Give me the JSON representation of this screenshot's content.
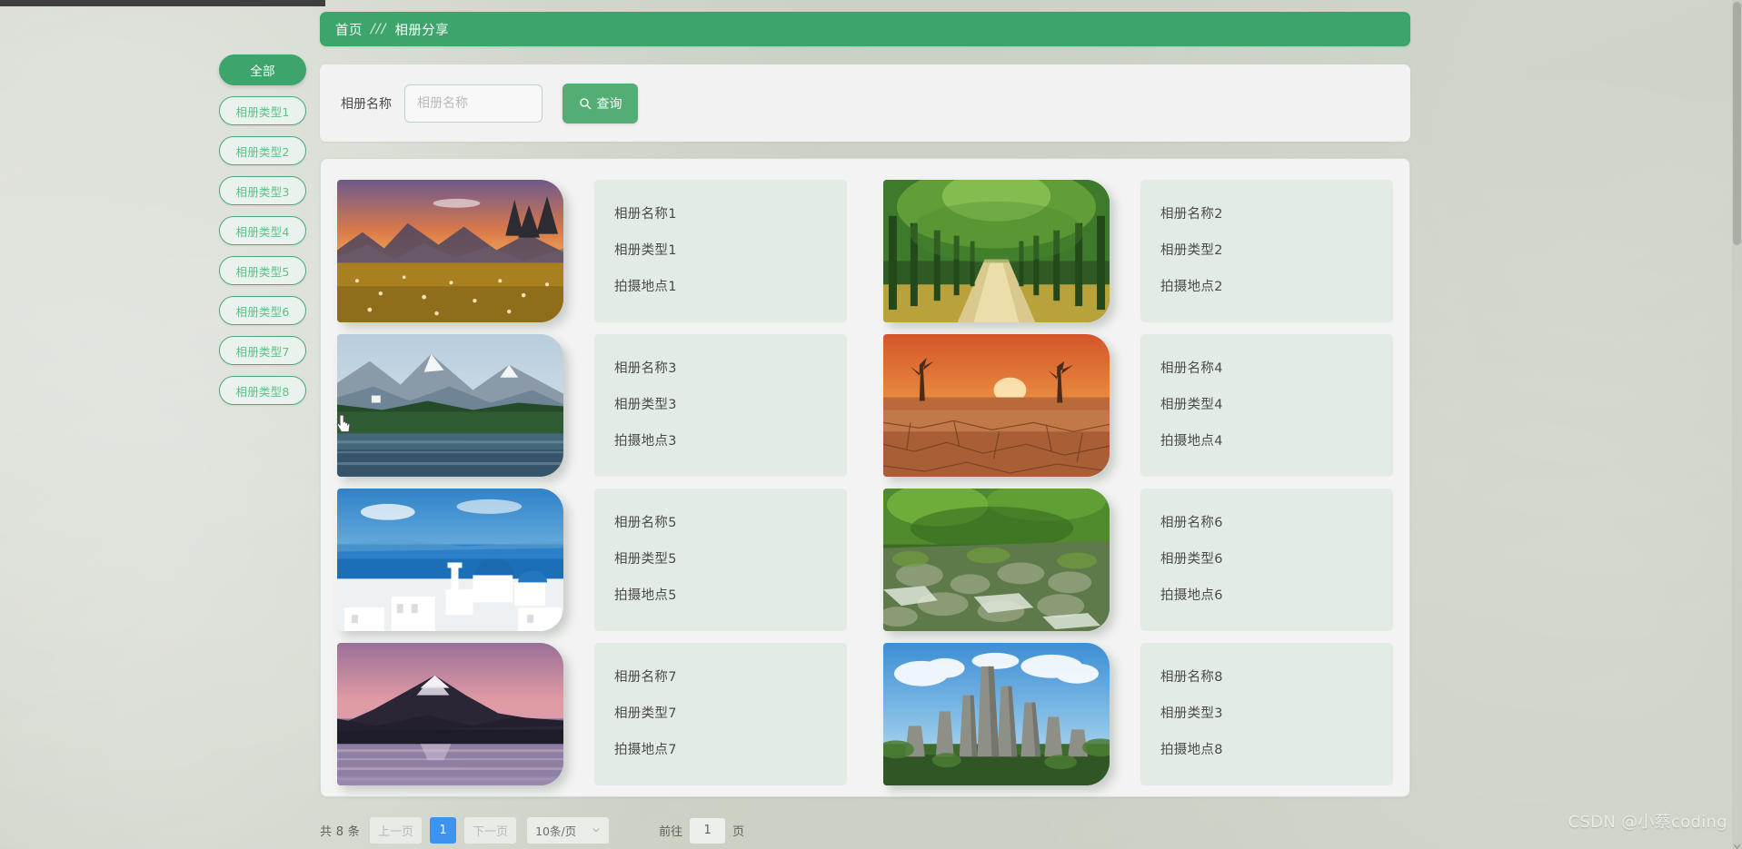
{
  "breadcrumb": {
    "home": "首页",
    "separator": "///",
    "current": "相册分享"
  },
  "sidebar": {
    "items": [
      {
        "label": "全部",
        "active": true
      },
      {
        "label": "相册类型1",
        "active": false
      },
      {
        "label": "相册类型2",
        "active": false
      },
      {
        "label": "相册类型3",
        "active": false
      },
      {
        "label": "相册类型4",
        "active": false
      },
      {
        "label": "相册类型5",
        "active": false
      },
      {
        "label": "相册类型6",
        "active": false
      },
      {
        "label": "相册类型7",
        "active": false
      },
      {
        "label": "相册类型8",
        "active": false
      }
    ]
  },
  "search": {
    "label": "相册名称",
    "placeholder": "相册名称",
    "value": "",
    "button_label": "查询",
    "button_icon": "search-icon"
  },
  "gallery": {
    "cards": [
      {
        "name": "相册名称1",
        "type": "相册类型1",
        "location": "拍摄地点1",
        "image": "sunset-wildflower-meadow"
      },
      {
        "name": "相册名称2",
        "type": "相册类型2",
        "location": "拍摄地点2",
        "image": "tree-lined-road"
      },
      {
        "name": "相册名称3",
        "type": "相册类型3",
        "location": "拍摄地点3",
        "image": "alpine-lake-mountain"
      },
      {
        "name": "相册名称4",
        "type": "相册类型4",
        "location": "拍摄地点4",
        "image": "cracked-desert-sunset"
      },
      {
        "name": "相册名称5",
        "type": "相册类型5",
        "location": "拍摄地点5",
        "image": "santorini-blue-domes"
      },
      {
        "name": "相册名称6",
        "type": "相册类型6",
        "location": "拍摄地点6",
        "image": "mossy-forest-stream"
      },
      {
        "name": "相册名称7",
        "type": "相册类型7",
        "location": "拍摄地点7",
        "image": "pink-sunset-lake"
      },
      {
        "name": "相册名称8",
        "type": "相册类型3",
        "location": "拍摄地点8",
        "image": "stone-forest-pillars"
      }
    ]
  },
  "pagination": {
    "total": "共 8 条",
    "prev": "上一页",
    "current_page": "1",
    "next": "下一页",
    "page_size": "10条/页",
    "jump_prefix": "前往",
    "jump_value": "1",
    "jump_suffix": "页"
  },
  "watermark": "CSDN @小蔡coding",
  "colors": {
    "brand_green": "#3da56c",
    "button_green": "#53ae74",
    "active_page_blue": "#3c93f0",
    "panel_bg": "#f2f3f2",
    "info_bg": "#e3ebe5",
    "desktop_bg": "#c9cfc2"
  }
}
